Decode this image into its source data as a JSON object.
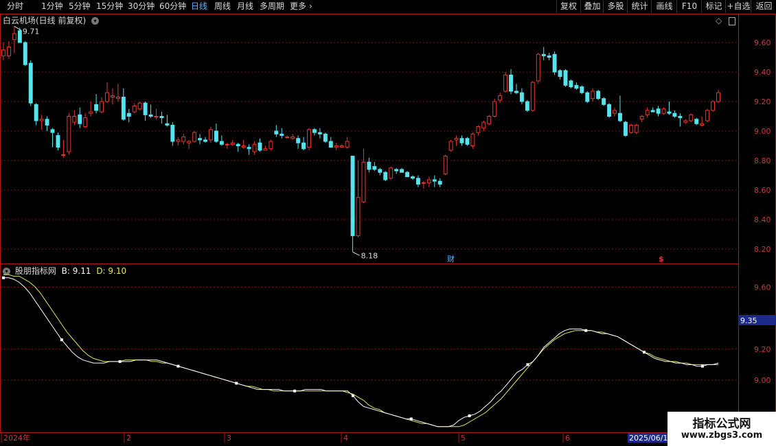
{
  "toolbar": {
    "periods": [
      "分时",
      "1分钟",
      "5分钟",
      "15分钟",
      "30分钟",
      "60分钟",
      "日线",
      "周线",
      "月线",
      "多周期",
      "更多"
    ],
    "active": "日线",
    "more_arrow": "›",
    "buttons": [
      "复权",
      "叠加",
      "多股",
      "统计",
      "画线",
      "F10",
      "标记",
      "+自选",
      "返回"
    ]
  },
  "main_panel": {
    "title": "白云机场(日线 前复权)",
    "max_label": "9.71",
    "min_label": "8.18",
    "event_cai": "财",
    "event_dollar": "$",
    "y_ticks": [
      "9.60",
      "9.40",
      "9.20",
      "9.00",
      "8.80",
      "8.60",
      "8.40",
      "8.20"
    ],
    "y_values": [
      9.6,
      9.4,
      9.2,
      9.0,
      8.8,
      8.6,
      8.4,
      8.2
    ]
  },
  "indicator_panel": {
    "name": "股朋指标网",
    "b_label": "B: 9.11",
    "d_label": "D: 9.10",
    "current_marker": "9.35",
    "y_ticks": [
      "9.60",
      "9.20",
      "9.00"
    ],
    "y_values": [
      9.6,
      9.2,
      9.0
    ]
  },
  "x_axis": {
    "labels": [
      "2024年",
      "2",
      "3",
      "4",
      "5",
      "6"
    ],
    "highlight": "2025/06/1"
  },
  "watermark": {
    "title": "指标公式网",
    "url": "www.zbgs3.com"
  },
  "colors": {
    "up": "#e8392f",
    "down": "#55e4ee",
    "grid": "#7a1515",
    "b_line": "#ffffff",
    "d_line": "#e9e65a",
    "active": "#57b7ff"
  },
  "chart_data": {
    "type": "candlestick",
    "candles": [
      {
        "o": 9.51,
        "h": 9.6,
        "l": 9.48,
        "c": 9.55
      },
      {
        "o": 9.51,
        "h": 9.61,
        "l": 9.49,
        "c": 9.57
      },
      {
        "o": 9.62,
        "h": 9.71,
        "l": 9.53,
        "c": 9.66
      },
      {
        "o": 9.68,
        "h": 9.7,
        "l": 9.6,
        "c": 9.6
      },
      {
        "o": 9.6,
        "h": 9.61,
        "l": 9.44,
        "c": 9.45
      },
      {
        "o": 9.46,
        "h": 9.48,
        "l": 9.17,
        "c": 9.19
      },
      {
        "o": 9.18,
        "h": 9.19,
        "l": 9.04,
        "c": 9.07
      },
      {
        "o": 9.07,
        "h": 9.11,
        "l": 9.01,
        "c": 9.08
      },
      {
        "o": 9.08,
        "h": 9.1,
        "l": 9.0,
        "c": 9.04
      },
      {
        "o": 9.01,
        "h": 9.02,
        "l": 8.89,
        "c": 8.99
      },
      {
        "o": 8.97,
        "h": 8.99,
        "l": 8.87,
        "c": 8.89
      },
      {
        "o": 8.84,
        "h": 8.94,
        "l": 8.82,
        "c": 8.84
      },
      {
        "o": 8.86,
        "h": 9.12,
        "l": 8.84,
        "c": 9.1
      },
      {
        "o": 9.06,
        "h": 9.14,
        "l": 9.04,
        "c": 9.1
      },
      {
        "o": 9.11,
        "h": 9.16,
        "l": 9.02,
        "c": 9.05
      },
      {
        "o": 9.03,
        "h": 9.12,
        "l": 9.02,
        "c": 9.09
      },
      {
        "o": 9.12,
        "h": 9.2,
        "l": 9.1,
        "c": 9.13
      },
      {
        "o": 9.18,
        "h": 9.25,
        "l": 9.12,
        "c": 9.14
      },
      {
        "o": 9.13,
        "h": 9.23,
        "l": 9.12,
        "c": 9.2
      },
      {
        "o": 9.2,
        "h": 9.33,
        "l": 9.19,
        "c": 9.26
      },
      {
        "o": 9.23,
        "h": 9.29,
        "l": 9.18,
        "c": 9.24
      },
      {
        "o": 9.22,
        "h": 9.32,
        "l": 9.2,
        "c": 9.23
      },
      {
        "o": 9.23,
        "h": 9.29,
        "l": 9.07,
        "c": 9.08
      },
      {
        "o": 9.12,
        "h": 9.15,
        "l": 9.06,
        "c": 9.1
      },
      {
        "o": 9.13,
        "h": 9.19,
        "l": 9.12,
        "c": 9.17
      },
      {
        "o": 9.15,
        "h": 9.2,
        "l": 9.14,
        "c": 9.19
      },
      {
        "o": 9.19,
        "h": 9.2,
        "l": 9.07,
        "c": 9.11
      },
      {
        "o": 9.11,
        "h": 9.18,
        "l": 9.09,
        "c": 9.1
      },
      {
        "o": 9.1,
        "h": 9.15,
        "l": 9.08,
        "c": 9.1
      },
      {
        "o": 9.1,
        "h": 9.13,
        "l": 9.05,
        "c": 9.09
      },
      {
        "o": 9.05,
        "h": 9.11,
        "l": 9.03,
        "c": 9.04
      },
      {
        "o": 9.04,
        "h": 9.06,
        "l": 8.9,
        "c": 8.93
      },
      {
        "o": 8.93,
        "h": 8.96,
        "l": 8.9,
        "c": 8.94
      },
      {
        "o": 8.93,
        "h": 8.98,
        "l": 8.91,
        "c": 8.96
      },
      {
        "o": 8.92,
        "h": 8.94,
        "l": 8.88,
        "c": 8.93
      },
      {
        "o": 8.93,
        "h": 9.0,
        "l": 8.92,
        "c": 8.99
      },
      {
        "o": 8.95,
        "h": 8.98,
        "l": 8.91,
        "c": 8.94
      },
      {
        "o": 8.94,
        "h": 8.96,
        "l": 8.92,
        "c": 8.93
      },
      {
        "o": 8.94,
        "h": 9.03,
        "l": 8.92,
        "c": 9.01
      },
      {
        "o": 9.0,
        "h": 9.05,
        "l": 8.92,
        "c": 8.93
      },
      {
        "o": 8.93,
        "h": 8.97,
        "l": 8.9,
        "c": 8.91
      },
      {
        "o": 8.91,
        "h": 8.92,
        "l": 8.88,
        "c": 8.91
      },
      {
        "o": 8.91,
        "h": 8.94,
        "l": 8.9,
        "c": 8.92
      },
      {
        "o": 8.91,
        "h": 8.92,
        "l": 8.86,
        "c": 8.9
      },
      {
        "o": 8.89,
        "h": 8.94,
        "l": 8.88,
        "c": 8.9
      },
      {
        "o": 8.89,
        "h": 8.91,
        "l": 8.84,
        "c": 8.88
      },
      {
        "o": 8.86,
        "h": 8.93,
        "l": 8.84,
        "c": 8.91
      },
      {
        "o": 8.92,
        "h": 8.95,
        "l": 8.86,
        "c": 8.87
      },
      {
        "o": 8.87,
        "h": 8.9,
        "l": 8.87,
        "c": 8.88
      },
      {
        "o": 8.88,
        "h": 8.94,
        "l": 8.87,
        "c": 8.93
      },
      {
        "o": 9.0,
        "h": 9.04,
        "l": 8.96,
        "c": 8.98
      },
      {
        "o": 8.98,
        "h": 9.02,
        "l": 8.95,
        "c": 8.97
      },
      {
        "o": 8.96,
        "h": 8.97,
        "l": 8.95,
        "c": 8.96
      },
      {
        "o": 8.95,
        "h": 8.98,
        "l": 8.94,
        "c": 8.96
      },
      {
        "o": 8.95,
        "h": 8.97,
        "l": 8.88,
        "c": 8.92
      },
      {
        "o": 8.92,
        "h": 8.96,
        "l": 8.87,
        "c": 8.88
      },
      {
        "o": 8.89,
        "h": 9.02,
        "l": 8.87,
        "c": 9.01
      },
      {
        "o": 9.01,
        "h": 9.02,
        "l": 8.97,
        "c": 8.99
      },
      {
        "o": 8.99,
        "h": 9.02,
        "l": 8.95,
        "c": 8.98
      },
      {
        "o": 8.98,
        "h": 8.99,
        "l": 8.92,
        "c": 8.93
      },
      {
        "o": 8.93,
        "h": 8.96,
        "l": 8.89,
        "c": 8.89
      },
      {
        "o": 8.89,
        "h": 8.92,
        "l": 8.87,
        "c": 8.9
      },
      {
        "o": 8.89,
        "h": 8.91,
        "l": 8.89,
        "c": 8.9
      },
      {
        "o": 8.89,
        "h": 8.96,
        "l": 8.88,
        "c": 8.93
      },
      {
        "o": 8.83,
        "h": 8.83,
        "l": 8.18,
        "c": 8.29
      },
      {
        "o": 8.29,
        "h": 8.8,
        "l": 8.28,
        "c": 8.55
      },
      {
        "o": 8.52,
        "h": 8.88,
        "l": 8.51,
        "c": 8.79
      },
      {
        "o": 8.79,
        "h": 8.82,
        "l": 8.72,
        "c": 8.74
      },
      {
        "o": 8.76,
        "h": 8.79,
        "l": 8.73,
        "c": 8.74
      },
      {
        "o": 8.74,
        "h": 8.75,
        "l": 8.7,
        "c": 8.72
      },
      {
        "o": 8.72,
        "h": 8.73,
        "l": 8.66,
        "c": 8.67
      },
      {
        "o": 8.68,
        "h": 8.76,
        "l": 8.67,
        "c": 8.75
      },
      {
        "o": 8.74,
        "h": 8.75,
        "l": 8.71,
        "c": 8.73
      },
      {
        "o": 8.74,
        "h": 8.75,
        "l": 8.72,
        "c": 8.72
      },
      {
        "o": 8.72,
        "h": 8.73,
        "l": 8.69,
        "c": 8.69
      },
      {
        "o": 8.69,
        "h": 8.7,
        "l": 8.67,
        "c": 8.68
      },
      {
        "o": 8.68,
        "h": 8.7,
        "l": 8.62,
        "c": 8.64
      },
      {
        "o": 8.65,
        "h": 8.66,
        "l": 8.61,
        "c": 8.65
      },
      {
        "o": 8.65,
        "h": 8.69,
        "l": 8.62,
        "c": 8.67
      },
      {
        "o": 8.67,
        "h": 8.7,
        "l": 8.62,
        "c": 8.66
      },
      {
        "o": 8.66,
        "h": 8.68,
        "l": 8.62,
        "c": 8.64
      },
      {
        "o": 8.71,
        "h": 8.84,
        "l": 8.7,
        "c": 8.83
      },
      {
        "o": 8.87,
        "h": 8.94,
        "l": 8.86,
        "c": 8.93
      },
      {
        "o": 8.94,
        "h": 8.97,
        "l": 8.9,
        "c": 8.95
      },
      {
        "o": 8.95,
        "h": 8.97,
        "l": 8.9,
        "c": 8.92
      },
      {
        "o": 8.95,
        "h": 8.96,
        "l": 8.9,
        "c": 8.91
      },
      {
        "o": 8.9,
        "h": 8.99,
        "l": 8.88,
        "c": 8.98
      },
      {
        "o": 8.99,
        "h": 9.04,
        "l": 8.97,
        "c": 9.03
      },
      {
        "o": 9.02,
        "h": 9.07,
        "l": 9.0,
        "c": 9.06
      },
      {
        "o": 9.05,
        "h": 9.11,
        "l": 9.04,
        "c": 9.1
      },
      {
        "o": 9.1,
        "h": 9.22,
        "l": 9.09,
        "c": 9.2
      },
      {
        "o": 9.21,
        "h": 9.26,
        "l": 9.19,
        "c": 9.24
      },
      {
        "o": 9.27,
        "h": 9.4,
        "l": 9.26,
        "c": 9.38
      },
      {
        "o": 9.38,
        "h": 9.42,
        "l": 9.25,
        "c": 9.27
      },
      {
        "o": 9.27,
        "h": 9.32,
        "l": 9.25,
        "c": 9.26
      },
      {
        "o": 9.26,
        "h": 9.29,
        "l": 9.18,
        "c": 9.2
      },
      {
        "o": 9.2,
        "h": 9.21,
        "l": 9.13,
        "c": 9.14
      },
      {
        "o": 9.14,
        "h": 9.34,
        "l": 9.13,
        "c": 9.33
      },
      {
        "o": 9.34,
        "h": 9.53,
        "l": 9.32,
        "c": 9.52
      },
      {
        "o": 9.52,
        "h": 9.57,
        "l": 9.48,
        "c": 9.51
      },
      {
        "o": 9.51,
        "h": 9.53,
        "l": 9.48,
        "c": 9.5
      },
      {
        "o": 9.52,
        "h": 9.54,
        "l": 9.38,
        "c": 9.4
      },
      {
        "o": 9.41,
        "h": 9.42,
        "l": 9.35,
        "c": 9.37
      },
      {
        "o": 9.41,
        "h": 9.42,
        "l": 9.3,
        "c": 9.31
      },
      {
        "o": 9.34,
        "h": 9.35,
        "l": 9.29,
        "c": 9.3
      },
      {
        "o": 9.31,
        "h": 9.33,
        "l": 9.28,
        "c": 9.29
      },
      {
        "o": 9.3,
        "h": 9.31,
        "l": 9.25,
        "c": 9.26
      },
      {
        "o": 9.26,
        "h": 9.27,
        "l": 9.19,
        "c": 9.2
      },
      {
        "o": 9.22,
        "h": 9.29,
        "l": 9.2,
        "c": 9.27
      },
      {
        "o": 9.27,
        "h": 9.28,
        "l": 9.21,
        "c": 9.22
      },
      {
        "o": 9.22,
        "h": 9.23,
        "l": 9.17,
        "c": 9.18
      },
      {
        "o": 9.18,
        "h": 9.19,
        "l": 9.09,
        "c": 9.1
      },
      {
        "o": 9.12,
        "h": 9.16,
        "l": 9.1,
        "c": 9.14
      },
      {
        "o": 9.12,
        "h": 9.24,
        "l": 9.06,
        "c": 9.07
      },
      {
        "o": 9.06,
        "h": 9.07,
        "l": 8.96,
        "c": 8.97
      },
      {
        "o": 8.99,
        "h": 9.05,
        "l": 8.98,
        "c": 9.04
      },
      {
        "o": 8.99,
        "h": 9.05,
        "l": 8.98,
        "c": 9.04
      },
      {
        "o": 9.08,
        "h": 9.11,
        "l": 9.06,
        "c": 9.1
      },
      {
        "o": 9.11,
        "h": 9.16,
        "l": 9.09,
        "c": 9.14
      },
      {
        "o": 9.14,
        "h": 9.16,
        "l": 9.13,
        "c": 9.13
      },
      {
        "o": 9.15,
        "h": 9.17,
        "l": 9.1,
        "c": 9.12
      },
      {
        "o": 9.12,
        "h": 9.16,
        "l": 9.11,
        "c": 9.15
      },
      {
        "o": 9.13,
        "h": 9.2,
        "l": 9.11,
        "c": 9.12
      },
      {
        "o": 9.12,
        "h": 9.14,
        "l": 9.09,
        "c": 9.1
      },
      {
        "o": 9.1,
        "h": 9.12,
        "l": 9.03,
        "c": 9.09
      },
      {
        "o": 9.06,
        "h": 9.08,
        "l": 9.05,
        "c": 9.07
      },
      {
        "o": 9.07,
        "h": 9.12,
        "l": 9.06,
        "c": 9.11
      },
      {
        "o": 9.08,
        "h": 9.09,
        "l": 9.04,
        "c": 9.05
      },
      {
        "o": 9.04,
        "h": 9.1,
        "l": 9.03,
        "c": 9.05
      },
      {
        "o": 9.07,
        "h": 9.15,
        "l": 9.06,
        "c": 9.14
      },
      {
        "o": 9.14,
        "h": 9.21,
        "l": 9.13,
        "c": 9.2
      },
      {
        "o": 9.2,
        "h": 9.28,
        "l": 9.19,
        "c": 9.26
      }
    ],
    "indicator": {
      "B": [
        9.66,
        9.66,
        9.65,
        9.63,
        9.6,
        9.56,
        9.51,
        9.46,
        9.41,
        9.36,
        9.31,
        9.26,
        9.22,
        9.18,
        9.15,
        9.13,
        9.12,
        9.11,
        9.11,
        9.11,
        9.12,
        9.12,
        9.12,
        9.12,
        9.12,
        9.13,
        9.13,
        9.13,
        9.13,
        9.13,
        9.12,
        9.11,
        9.1,
        9.09,
        9.08,
        9.07,
        9.06,
        9.05,
        9.04,
        9.03,
        9.02,
        9.01,
        9.0,
        8.99,
        8.98,
        8.97,
        8.96,
        8.95,
        8.94,
        8.94,
        8.94,
        8.94,
        8.94,
        8.93,
        8.93,
        8.93,
        8.93,
        8.94,
        8.94,
        8.94,
        8.94,
        8.93,
        8.93,
        8.93,
        8.93,
        8.93,
        8.9,
        8.86,
        8.83,
        8.82,
        8.81,
        8.8,
        8.79,
        8.78,
        8.77,
        8.76,
        8.75,
        8.75,
        8.74,
        8.73,
        8.72,
        8.71,
        8.7,
        8.7,
        8.7,
        8.71,
        8.74,
        8.76,
        8.77,
        8.78,
        8.8,
        8.83,
        8.86,
        8.9,
        8.93,
        8.97,
        9.01,
        9.05,
        9.07,
        9.1,
        9.12,
        9.16,
        9.21,
        9.24,
        9.27,
        9.3,
        9.32,
        9.33,
        9.33,
        9.33,
        9.32,
        9.32,
        9.31,
        9.3,
        9.3,
        9.29,
        9.28,
        9.26,
        9.24,
        9.22,
        9.2,
        9.18,
        9.16,
        9.14,
        9.13,
        9.12,
        9.12,
        9.11,
        9.11,
        9.1,
        9.1,
        9.09,
        9.09,
        9.1,
        9.1,
        9.11
      ],
      "D": [
        9.68,
        9.68,
        9.67,
        9.67,
        9.65,
        9.63,
        9.6,
        9.56,
        9.51,
        9.46,
        9.41,
        9.36,
        9.31,
        9.27,
        9.23,
        9.19,
        9.16,
        9.14,
        9.13,
        9.12,
        9.12,
        9.12,
        9.12,
        9.13,
        9.13,
        9.13,
        9.13,
        9.13,
        9.12,
        9.12,
        9.11,
        9.11,
        9.1,
        9.09,
        9.08,
        9.07,
        9.06,
        9.05,
        9.04,
        9.03,
        9.02,
        9.01,
        9.0,
        8.99,
        8.98,
        8.97,
        8.96,
        8.96,
        8.95,
        8.94,
        8.94,
        8.93,
        8.93,
        8.93,
        8.93,
        8.93,
        8.93,
        8.93,
        8.93,
        8.93,
        8.93,
        8.93,
        8.93,
        8.93,
        8.93,
        8.92,
        8.91,
        8.89,
        8.87,
        8.84,
        8.82,
        8.81,
        8.79,
        8.78,
        8.77,
        8.76,
        8.75,
        8.74,
        8.73,
        8.72,
        8.72,
        8.71,
        8.7,
        8.7,
        8.7,
        8.7,
        8.7,
        8.71,
        8.73,
        8.75,
        8.77,
        8.79,
        8.82,
        8.85,
        8.88,
        8.92,
        8.96,
        9.0,
        9.04,
        9.08,
        9.12,
        9.16,
        9.2,
        9.23,
        9.26,
        9.28,
        9.3,
        9.31,
        9.32,
        9.32,
        9.32,
        9.32,
        9.31,
        9.31,
        9.3,
        9.29,
        9.28,
        9.26,
        9.24,
        9.22,
        9.2,
        9.18,
        9.17,
        9.15,
        9.14,
        9.13,
        9.12,
        9.12,
        9.11,
        9.11,
        9.1,
        9.1,
        9.1,
        9.1,
        9.1,
        9.1
      ]
    }
  }
}
